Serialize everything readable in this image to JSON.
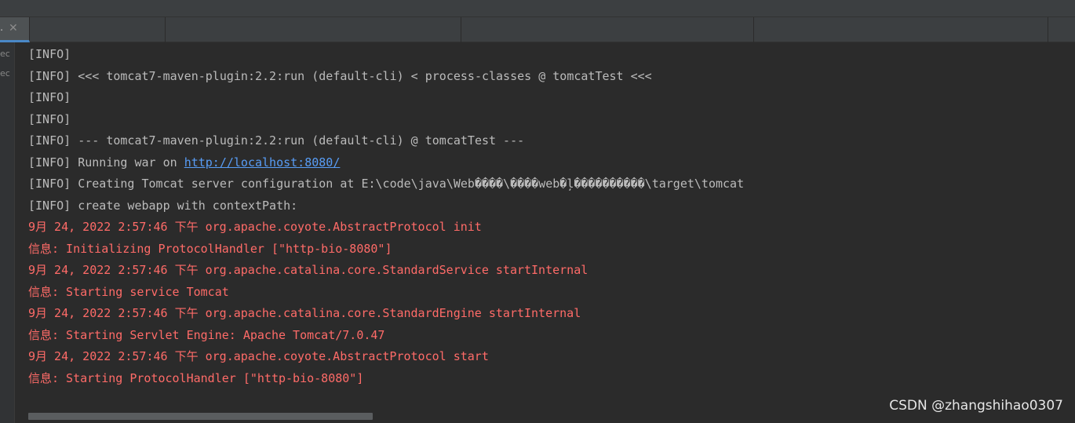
{
  "tabs": [
    {
      "label": "."
    },
    {
      "label": ""
    },
    {
      "label": ""
    },
    {
      "label": ""
    },
    {
      "label": ""
    }
  ],
  "gutter": {
    "items": [
      "ec",
      "ec"
    ]
  },
  "console": {
    "lines": [
      {
        "text": "[INFO]",
        "type": "info"
      },
      {
        "text": "[INFO] <<< tomcat7-maven-plugin:2.2:run (default-cli) < process-classes @ tomcatTest <<<",
        "type": "info"
      },
      {
        "text": "[INFO]",
        "type": "info"
      },
      {
        "text": "[INFO]",
        "type": "info"
      },
      {
        "text": "[INFO] --- tomcat7-maven-plugin:2.2:run (default-cli) @ tomcatTest ---",
        "type": "info"
      },
      {
        "prefix": "[INFO] Running war on ",
        "link": "http://localhost:8080/",
        "type": "info"
      },
      {
        "text": "[INFO] Creating Tomcat server configuration at E:\\code\\java\\Web����\\����web�ļ����������\\target\\tomcat",
        "type": "info"
      },
      {
        "text": "[INFO] create webapp with contextPath:",
        "type": "info"
      },
      {
        "text": "9月 24, 2022 2:57:46 下午 org.apache.coyote.AbstractProtocol init",
        "type": "error"
      },
      {
        "text": "信息: Initializing ProtocolHandler [\"http-bio-8080\"]",
        "type": "error"
      },
      {
        "text": "9月 24, 2022 2:57:46 下午 org.apache.catalina.core.StandardService startInternal",
        "type": "error"
      },
      {
        "text": "信息: Starting service Tomcat",
        "type": "error"
      },
      {
        "text": "9月 24, 2022 2:57:46 下午 org.apache.catalina.core.StandardEngine startInternal",
        "type": "error"
      },
      {
        "text": "信息: Starting Servlet Engine: Apache Tomcat/7.0.47",
        "type": "error"
      },
      {
        "text": "9月 24, 2022 2:57:46 下午 org.apache.coyote.AbstractProtocol start",
        "type": "error"
      },
      {
        "text": "信息: Starting ProtocolHandler [\"http-bio-8080\"]",
        "type": "error"
      }
    ]
  },
  "watermark": "CSDN @zhangshihao0307",
  "colors": {
    "background": "#2b2b2b",
    "info_text": "#bbbbbb",
    "error_text": "#ff6b68",
    "link": "#589df6",
    "tab_accent": "#4a88c7"
  }
}
